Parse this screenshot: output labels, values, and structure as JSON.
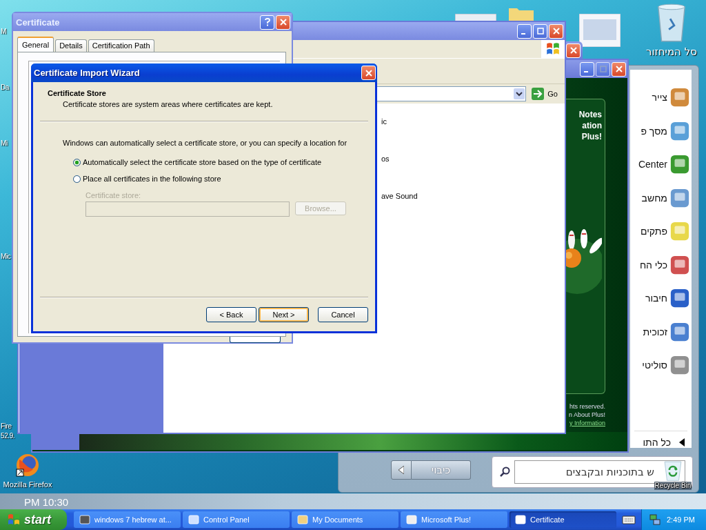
{
  "desktop": {
    "fragments": [
      "M",
      "Da",
      "Mi",
      "Mic",
      "Fire",
      "52.9."
    ],
    "icons": [
      {
        "label": "סל המיחזור",
        "kind": "recycle"
      },
      {
        "label": "Mozilla Firefox",
        "kind": "firefox"
      },
      {
        "label": "Recycle Bin",
        "kind": "recycle-small"
      }
    ]
  },
  "old_taskbar": {
    "clock": "PM 10:30"
  },
  "start_menu": {
    "programs": [
      {
        "label": "צייר",
        "kind": "paint"
      },
      {
        "label": "מסך פ",
        "kind": "screen"
      },
      {
        "label": "Center",
        "kind": "media"
      },
      {
        "label": "מחשב",
        "kind": "calculator"
      },
      {
        "label": "פתקים",
        "kind": "notes"
      },
      {
        "label": "כלי הח",
        "kind": "snip"
      },
      {
        "label": "חיבור",
        "kind": "remote"
      },
      {
        "label": "זכוכית",
        "kind": "magnifier"
      },
      {
        "label": "סוליטי",
        "kind": "cards"
      }
    ],
    "all_programs": "כל התו",
    "search": {
      "placeholder": "ש בתוכניות ובקבצים"
    },
    "shutdown": "כיבוי"
  },
  "plus_window": {
    "lines": [
      "Notes",
      "ation",
      "Plus!"
    ],
    "footer": [
      "hts reserved.",
      "n About Plus!"
    ],
    "link": "y Information"
  },
  "control_panel": {
    "go": "Go",
    "items": [
      "ic",
      "os",
      "ave Sound"
    ]
  },
  "certificate": {
    "title": "Certificate",
    "tabs": [
      {
        "label": "General",
        "selected": true
      },
      {
        "label": "Details",
        "selected": false
      },
      {
        "label": "Certification Path",
        "selected": false
      }
    ]
  },
  "wizard": {
    "title": "Certificate Import Wizard",
    "heading": "Certificate Store",
    "subheading": "Certificate stores are system areas where certificates are kept.",
    "intro": "Windows can automatically select a certificate store, or you can specify a location for",
    "options": [
      {
        "label": "Automatically select the certificate store based on the type of certificate",
        "selected": true
      },
      {
        "label": "Place all certificates in the following store",
        "selected": false
      }
    ],
    "store_field": {
      "label": "Certificate store:",
      "disabled": true
    },
    "browse": "Browse...",
    "buttons": [
      {
        "label": "< Back",
        "default": false
      },
      {
        "label": "Next >",
        "default": true
      },
      {
        "label": "Cancel",
        "default": false
      }
    ]
  },
  "taskbar": {
    "start": "start",
    "items": [
      {
        "label": "windows 7 hebrew at...",
        "kind": "raccoon",
        "selected": false
      },
      {
        "label": "Control Panel",
        "kind": "control",
        "selected": false
      },
      {
        "label": "My Documents",
        "kind": "documents",
        "selected": false
      },
      {
        "label": "Microsoft Plus!",
        "kind": "plus",
        "selected": false
      },
      {
        "label": "Certificate",
        "kind": "window",
        "selected": true
      }
    ],
    "clock": "2:49 PM"
  }
}
